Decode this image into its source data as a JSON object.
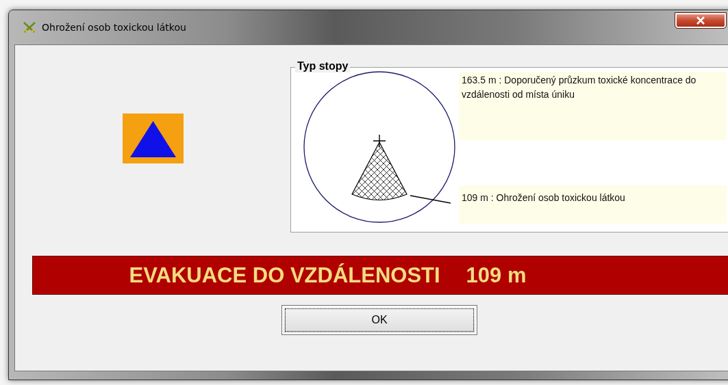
{
  "window": {
    "title": "Ohrožení osob toxickou látkou"
  },
  "trace_type": {
    "title": "Typ stopy",
    "labels": [
      "163.5 m : Doporučený průzkum toxické koncentrace do vzdálenosti od místa úniku",
      "109 m : Ohrožení osob toxickou látkou"
    ]
  },
  "banner": {
    "label": "EVAKUACE DO VZDÁLENOSTI",
    "distance": "109 m"
  },
  "buttons": [
    {
      "label": "OK",
      "focused": true
    }
  ]
}
